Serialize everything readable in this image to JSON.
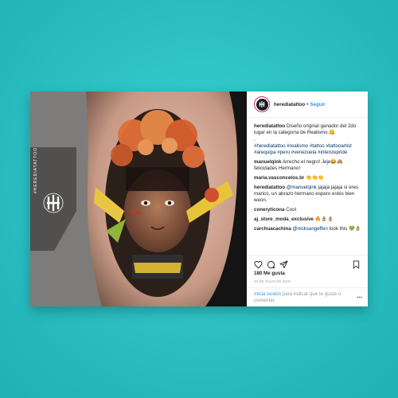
{
  "post": {
    "username": "herediatattoo",
    "follow_label": "Seguir",
    "dot": "•",
    "likes": "180 Me gusta",
    "date": "28 DE JULIO DE 2018",
    "login_link": "Inicia sesión",
    "login_text": " para indicar que te gusta o comentar.",
    "more_icon": "...",
    "watermark_text": "#HEREDIATATTOO"
  },
  "comments": [
    {
      "user": "herediatattoo",
      "text": " Diseño original ganador del 2do lugar en la categoría de Realismo.😋",
      "extra": ".",
      "tags": "#herediatattoo #realismo #tattoo #tattooartist #arequipa #peru #venezuela #intenzepride"
    },
    {
      "user": "manuelqink",
      "text": " Arrecho el negro! Jeje😂🙈 felicidades Hermano!"
    },
    {
      "user": "maria.vasconcelos.br",
      "text": " 👏👏👏"
    },
    {
      "user": "herediatattoo",
      "mention": " @manuelqink",
      "text": " jajaja jajaja si eres marico, un abrazo hermano espero estés bien weon."
    },
    {
      "user": "coneryticona",
      "text": " Cool"
    },
    {
      "user": "aj_store_moda_exclusive",
      "text": " 🔥👌🏽👌🏽"
    },
    {
      "user": "carchuacachina",
      "mention": " @nicksangeffen",
      "text": " look this 💚👌🏽"
    }
  ],
  "icons": {
    "heart": "heart-icon",
    "comment": "comment-icon",
    "share": "share-icon",
    "save": "bookmark-icon"
  },
  "colors": {
    "background": "#2cc3c6",
    "link": "#3897f0",
    "hashtag": "#003569"
  }
}
